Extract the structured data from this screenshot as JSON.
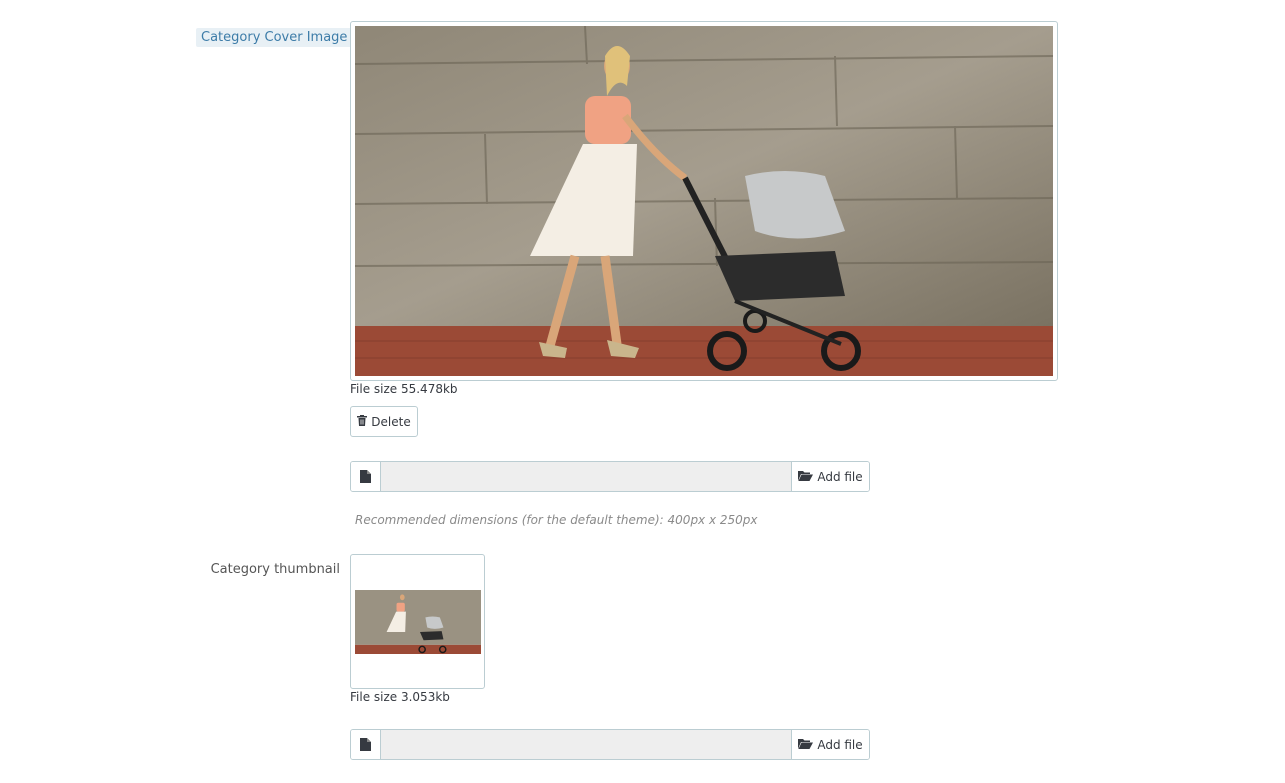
{
  "cover": {
    "label": "Category Cover Image",
    "file_size": "File size 55.478kb",
    "delete_label": "Delete",
    "add_file_label": "Add file",
    "file_value": "",
    "hint": "Recommended dimensions (for the default theme): 400px x 250px"
  },
  "thumbnail": {
    "label": "Category thumbnail",
    "file_size": "File size 3.053kb",
    "add_file_label": "Add file",
    "file_value": ""
  },
  "icons": {
    "trash": "trash-icon",
    "file": "file-icon",
    "folder_open": "folder-open-icon"
  },
  "colors": {
    "label_highlight_bg": "#e8f0f5",
    "label_highlight_text": "#3d7ca8",
    "input_bg": "#eeeeee",
    "border": "#bbcdd2"
  }
}
